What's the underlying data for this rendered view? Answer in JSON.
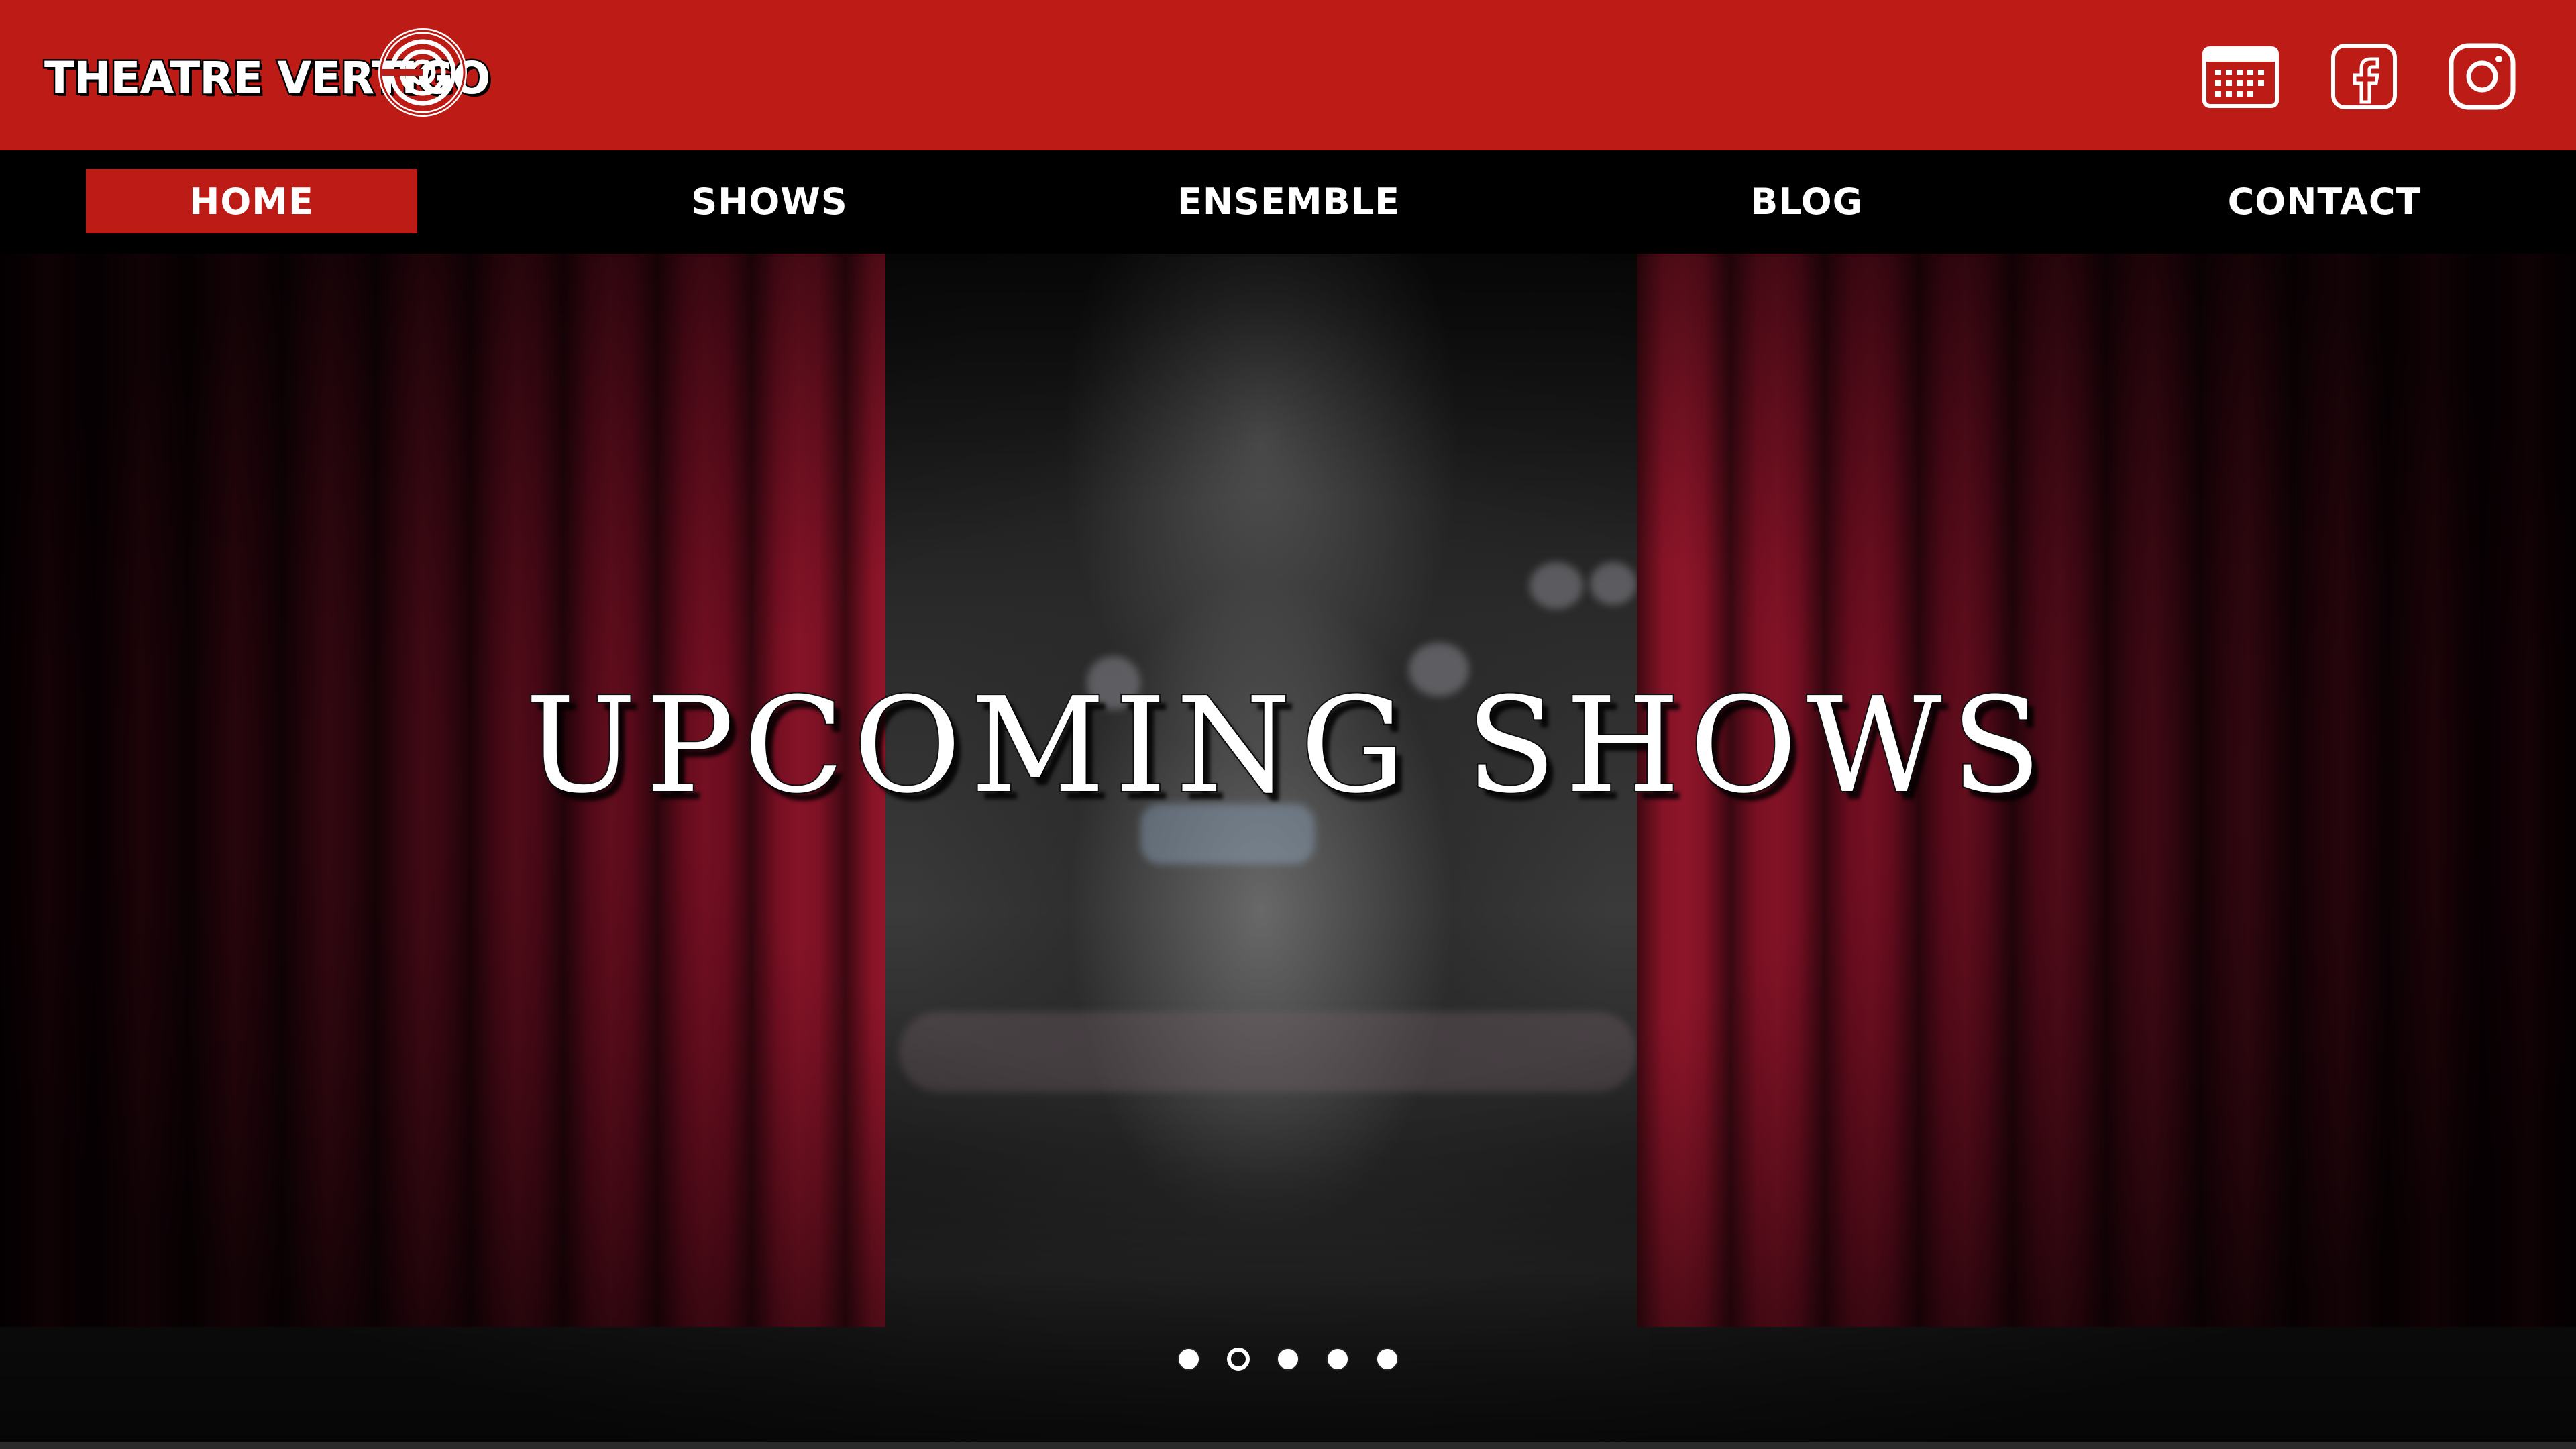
{
  "header": {
    "logo_text": "THEATRE VERTIGO",
    "brand_color": "#bd1c16",
    "icons": [
      "calendar-icon",
      "facebook-icon",
      "instagram-icon"
    ]
  },
  "nav": {
    "items": [
      {
        "label": "HOME",
        "active": true
      },
      {
        "label": "SHOWS",
        "active": false
      },
      {
        "label": "ENSEMBLE",
        "active": false
      },
      {
        "label": "BLOG",
        "active": false
      },
      {
        "label": "CONTACT",
        "active": false
      }
    ]
  },
  "hero": {
    "title": "UPCOMING SHOWS",
    "slide_count": 5,
    "active_slide": 2
  }
}
